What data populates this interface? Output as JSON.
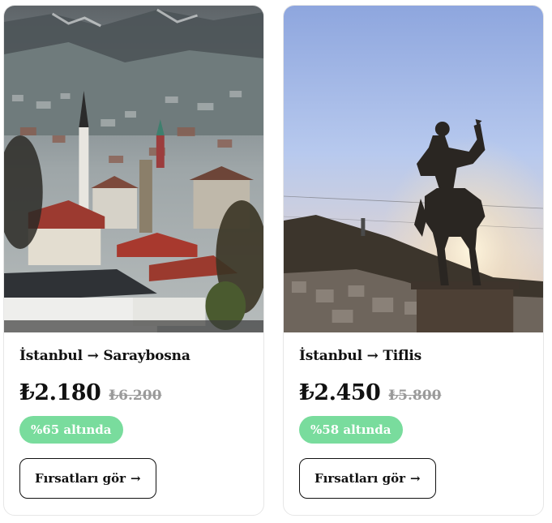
{
  "cards": [
    {
      "route": "İstanbul → Saraybosna",
      "price": "₺2.180",
      "old_price": "₺6.200",
      "discount_badge": "%65 altında",
      "cta_label": "Fırsatları gör",
      "cta_arrow": "→",
      "image_subject": "Sarajevo old town with minarets and red rooftops"
    },
    {
      "route": "İstanbul → Tiflis",
      "price": "₺2.450",
      "old_price": "₺5.800",
      "discount_badge": "%58 altında",
      "cta_label": "Fırsatları gör",
      "cta_arrow": "→",
      "image_subject": "Silhouette of equestrian statue in Tbilisi at sunset"
    }
  ],
  "colors": {
    "badge_bg": "#79dc9d",
    "text_primary": "#111111",
    "old_price": "#9a9a9a",
    "card_border": "#e6e6e6"
  }
}
